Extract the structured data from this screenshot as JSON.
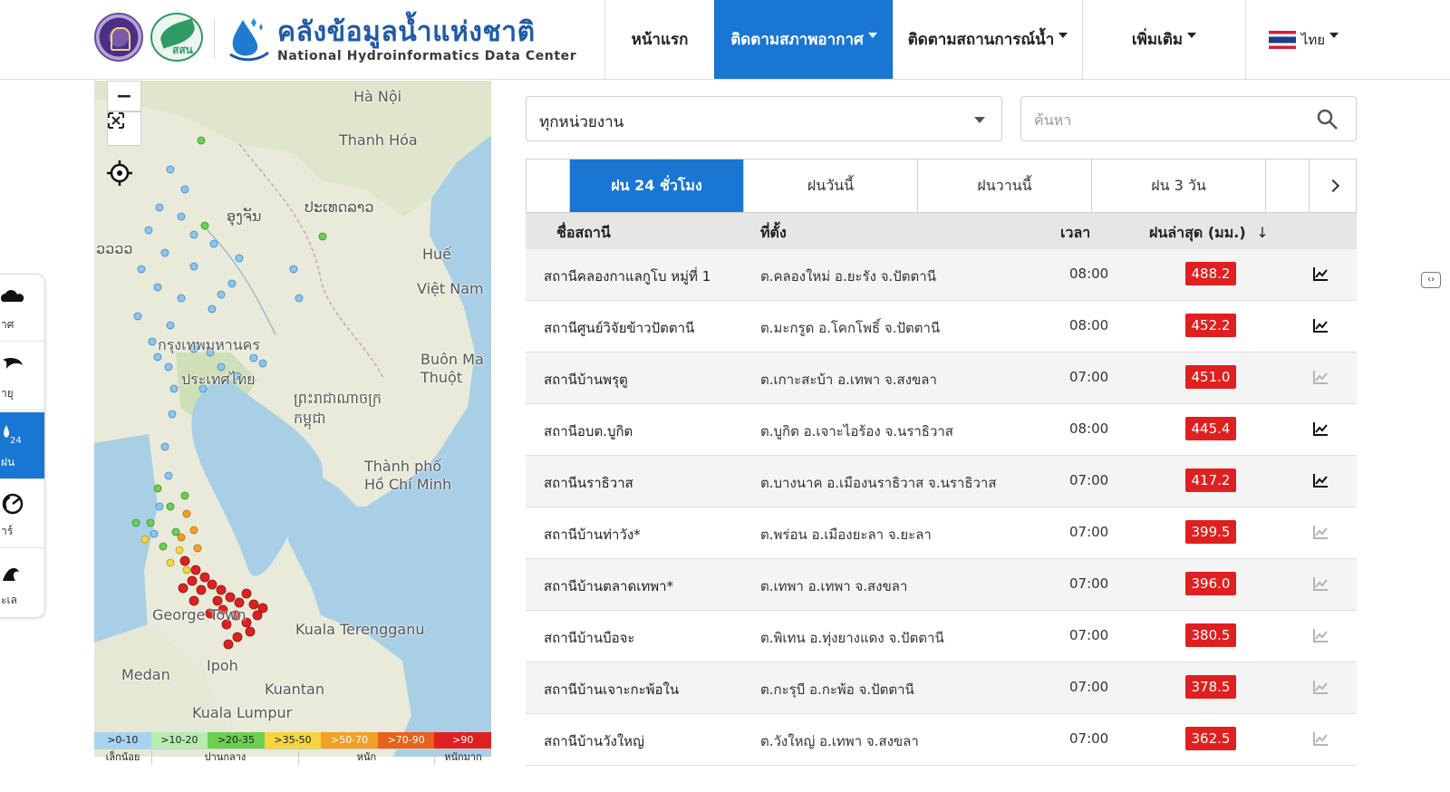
{
  "header": {
    "brand_title": "คลังข้อมูลน้ำแห่งชาติ",
    "brand_subtitle": "National Hydroinformatics Data Center",
    "leaf_logo_text": "สสน",
    "nav": [
      {
        "label": "หน้าแรก",
        "has_dropdown": false,
        "active": false
      },
      {
        "label": "ติดตามสภาพอากาศ",
        "has_dropdown": true,
        "active": true
      },
      {
        "label": "ติดตามสถานการณ์น้ำ",
        "has_dropdown": true,
        "active": false
      },
      {
        "label": "เพิ่มเติม",
        "has_dropdown": true,
        "active": false
      }
    ],
    "language": "ไทย",
    "accent_color": "#1976d2"
  },
  "dock": {
    "items": [
      {
        "label": "าศ",
        "icon": "cloud-icon",
        "active": false
      },
      {
        "label": "ายุ",
        "icon": "storm-icon",
        "active": false
      },
      {
        "label": "ฝน",
        "badge": "24",
        "icon": "rain-24-icon",
        "active": true
      },
      {
        "label": "าร์",
        "icon": "radar-icon",
        "active": false
      },
      {
        "label": "ะเล",
        "icon": "wave-icon",
        "active": false
      }
    ]
  },
  "map": {
    "zoom_out": "−",
    "places": [
      "Hà Nội",
      "Thanh Hóa",
      "ປະເທດລາວ",
      "ອຸງຈັນ",
      "Huế",
      "Việt Nam",
      "Buôn Ma Thuột",
      "ព្រះរាជាណាចក្រ កម្ពុជា",
      "กรุงเทพมหานคร",
      "ประเทศไทย",
      "Thành phố Hồ Chí Minh",
      "George Town",
      "Kuala Terengganu",
      "Medan",
      "Ipoh",
      "Kuantan",
      "Kuala Lumpur",
      "ວວວວ"
    ],
    "legend_ranges": [
      {
        "label": ">0-10",
        "color": "#a8d3f0"
      },
      {
        "label": ">10-20",
        "color": "#b6ecb0"
      },
      {
        "label": ">20-35",
        "color": "#6bcf52"
      },
      {
        "label": ">35-50",
        "color": "#f5d540"
      },
      {
        "label": ">50-70",
        "color": "#f2a127"
      },
      {
        "label": ">70-90",
        "color": "#e8611d"
      },
      {
        "label": ">90",
        "color": "#dd2121"
      }
    ],
    "legend_captions": [
      "เล็กน้อย",
      "ปานกลาง",
      "หนัก",
      "หนักมาก"
    ]
  },
  "filters": {
    "agency_value": "ทุกหน่วยงาน",
    "search_placeholder": "ค้นหา"
  },
  "tabs": [
    {
      "label": "ฝน 24 ชั่วโมง",
      "active": true
    },
    {
      "label": "ฝนวันนี้",
      "active": false
    },
    {
      "label": "ฝนวานนี้",
      "active": false
    },
    {
      "label": "ฝน 3 วัน",
      "active": false
    }
  ],
  "table": {
    "columns": [
      "ชื่อสถานี",
      "ที่ตั้ง",
      "เวลา",
      "ฝนล่าสุด (มม.)"
    ],
    "sort_indicator": "↓",
    "rows": [
      {
        "name": "สถานีคลองกาแลกูโบ หมู่ที่ 1",
        "location": "ต.คลองใหม่ อ.ยะรัง จ.ปัตตานี",
        "time": "08:00",
        "rain": "488.2",
        "chart_active": true
      },
      {
        "name": "สถานีศูนย์วิจัยข้าวปัตตานี",
        "location": "ต.มะกรูด อ.โคกโพธิ์ จ.ปัตตานี",
        "time": "08:00",
        "rain": "452.2",
        "chart_active": true
      },
      {
        "name": "สถานีบ้านพรุตู",
        "location": "ต.เกาะสะบ้า อ.เทพา จ.สงขลา",
        "time": "07:00",
        "rain": "451.0",
        "chart_active": false
      },
      {
        "name": "สถานีอบต.บูกิต",
        "location": "ต.บูกิต อ.เจาะไอร้อง จ.นราธิวาส",
        "time": "08:00",
        "rain": "445.4",
        "chart_active": true
      },
      {
        "name": "สถานีนราธิวาส",
        "location": "ต.บางนาค อ.เมืองนราธิวาส จ.นราธิวาส",
        "time": "07:00",
        "rain": "417.2",
        "chart_active": true
      },
      {
        "name": "สถานีบ้านท่าวัง*",
        "location": "ต.พร่อน อ.เมืองยะลา จ.ยะลา",
        "time": "07:00",
        "rain": "399.5",
        "chart_active": false
      },
      {
        "name": "สถานีบ้านตลาดเทพา*",
        "location": "ต.เทพา อ.เทพา จ.สงขลา",
        "time": "07:00",
        "rain": "396.0",
        "chart_active": false
      },
      {
        "name": "สถานีบ้านบือจะ",
        "location": "ต.พิเทน อ.ทุ่งยางแดง จ.ปัตตานี",
        "time": "07:00",
        "rain": "380.5",
        "chart_active": false
      },
      {
        "name": "สถานีบ้านเจาะกะพ้อใน",
        "location": "ต.กะรุบี อ.กะพ้อ จ.ปัตตานี",
        "time": "07:00",
        "rain": "378.5",
        "chart_active": false
      },
      {
        "name": "สถานีบ้านวังใหญ่",
        "location": "ต.วังใหญ่ อ.เทพา จ.สงขลา",
        "time": "07:00",
        "rain": "362.5",
        "chart_active": false
      }
    ]
  },
  "side_toggle": "‹›"
}
